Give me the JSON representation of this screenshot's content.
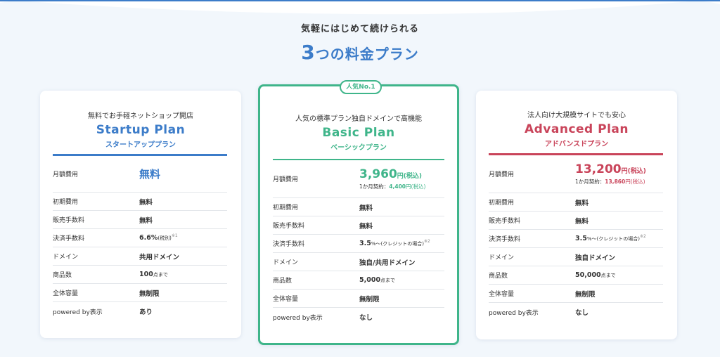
{
  "header": {
    "subtitle": "気軽にはじめて続けられる",
    "title_number": "3",
    "title_rest": "つの料金プラン"
  },
  "colors": {
    "startup": "#3c7cc9",
    "basic": "#3fb58a",
    "advanced": "#c9445a",
    "background": "#f2f7fc"
  },
  "plans": {
    "startup": {
      "tagline": "無料でお手軽ネットショップ開店",
      "name": "Startup Plan",
      "kana": "スタートアッププラン",
      "monthly_label": "月額費用",
      "monthly_value": "無料",
      "rows": [
        {
          "label": "初期費用",
          "value": "無料",
          "small": "",
          "note": ""
        },
        {
          "label": "販売手数料",
          "value": "無料",
          "small": "",
          "note": ""
        },
        {
          "label": "決済手数料",
          "value": "6.6%",
          "small": "(税別)",
          "note": "※1"
        },
        {
          "label": "ドメイン",
          "value": "共用ドメイン",
          "small": "",
          "note": ""
        },
        {
          "label": "商品数",
          "value": "100",
          "small": "点まで",
          "note": ""
        },
        {
          "label": "全体容量",
          "value": "無制限",
          "small": "",
          "note": ""
        },
        {
          "label": "powered by表示",
          "value": "あり",
          "small": "",
          "note": ""
        }
      ]
    },
    "basic": {
      "badge": "人気No.1",
      "tagline": "人気の標準プラン独自ドメインで高機能",
      "name": "Basic Plan",
      "kana": "ベーシックプラン",
      "monthly_label": "月額費用",
      "price": "3,960",
      "price_unit": "円(税込)",
      "yearly_label": "1か月契約：",
      "yearly_price": "4,400",
      "yearly_unit": "円(税込)",
      "rows": [
        {
          "label": "初期費用",
          "value": "無料",
          "small": "",
          "note": ""
        },
        {
          "label": "販売手数料",
          "value": "無料",
          "small": "",
          "note": ""
        },
        {
          "label": "決済手数料",
          "value": "3.5",
          "small": "%〜(クレジットの場合)",
          "note": "※2"
        },
        {
          "label": "ドメイン",
          "value": "独自/共用ドメイン",
          "small": "",
          "note": ""
        },
        {
          "label": "商品数",
          "value": "5,000",
          "small": "点まで",
          "note": ""
        },
        {
          "label": "全体容量",
          "value": "無制限",
          "small": "",
          "note": ""
        },
        {
          "label": "powered by表示",
          "value": "なし",
          "small": "",
          "note": ""
        }
      ]
    },
    "advanced": {
      "tagline": "法人向け大規模サイトでも安心",
      "name": "Advanced Plan",
      "kana": "アドバンスドプラン",
      "monthly_label": "月額費用",
      "price": "13,200",
      "price_unit": "円(税込)",
      "yearly_label": "1か月契約：",
      "yearly_price": "13,860",
      "yearly_unit": "円(税込)",
      "rows": [
        {
          "label": "初期費用",
          "value": "無料",
          "small": "",
          "note": ""
        },
        {
          "label": "販売手数料",
          "value": "無料",
          "small": "",
          "note": ""
        },
        {
          "label": "決済手数料",
          "value": "3.5",
          "small": "%〜(クレジットの場合)",
          "note": "※2"
        },
        {
          "label": "ドメイン",
          "value": "独自ドメイン",
          "small": "",
          "note": ""
        },
        {
          "label": "商品数",
          "value": "50,000",
          "small": "点まで",
          "note": ""
        },
        {
          "label": "全体容量",
          "value": "無制限",
          "small": "",
          "note": ""
        },
        {
          "label": "powered by表示",
          "value": "なし",
          "small": "",
          "note": ""
        }
      ]
    }
  }
}
